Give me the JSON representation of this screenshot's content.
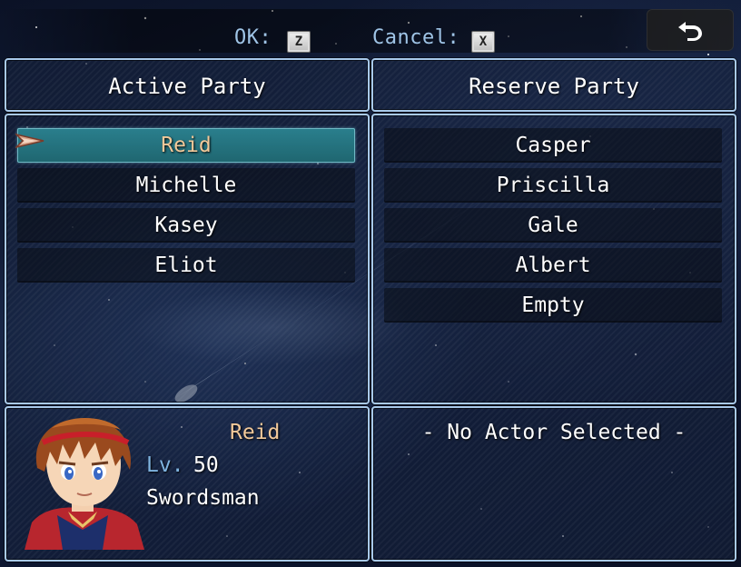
{
  "help": {
    "ok_label": "OK:",
    "ok_key": "Z",
    "cancel_label": "Cancel:",
    "cancel_key": "X"
  },
  "back_button": {
    "icon": "return-arrow-icon"
  },
  "active_party": {
    "title": "Active Party",
    "members": [
      "Reid",
      "Michelle",
      "Kasey",
      "Eliot"
    ],
    "selected_index": 0
  },
  "reserve_party": {
    "title": "Reserve Party",
    "members": [
      "Casper",
      "Priscilla",
      "Gale",
      "Albert",
      "Empty"
    ]
  },
  "status": {
    "name": "Reid",
    "level_label": "Lv.",
    "level": "50",
    "class": "Swordsman"
  },
  "detail": {
    "text": "- No Actor Selected -"
  },
  "colors": {
    "window_border": "#a8c9ea",
    "selected_slot": "#2a7f8d",
    "highlight_text": "#f2c99a",
    "system_text": "#7fb4e0"
  }
}
